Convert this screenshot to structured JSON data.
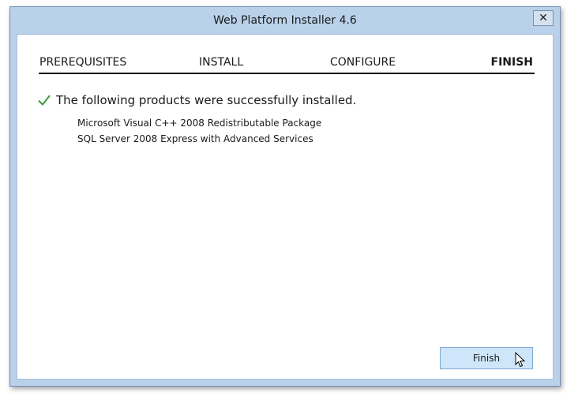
{
  "window": {
    "title": "Web Platform Installer 4.6",
    "close_glyph": "✕"
  },
  "steps": [
    {
      "label": "PREREQUISITES",
      "active": false
    },
    {
      "label": "INSTALL",
      "active": false
    },
    {
      "label": "CONFIGURE",
      "active": false
    },
    {
      "label": "FINISH",
      "active": true
    }
  ],
  "result": {
    "message": "The following products were successfully installed.",
    "icon": "checkmark-icon",
    "products": [
      "Microsoft Visual C++ 2008 Redistributable Package",
      "SQL Server 2008 Express with Advanced Services"
    ]
  },
  "buttons": {
    "finish_label": "Finish"
  },
  "colors": {
    "chrome": "#b9d1ea",
    "check": "#3a9a3a",
    "button": "#cfe6fa"
  }
}
